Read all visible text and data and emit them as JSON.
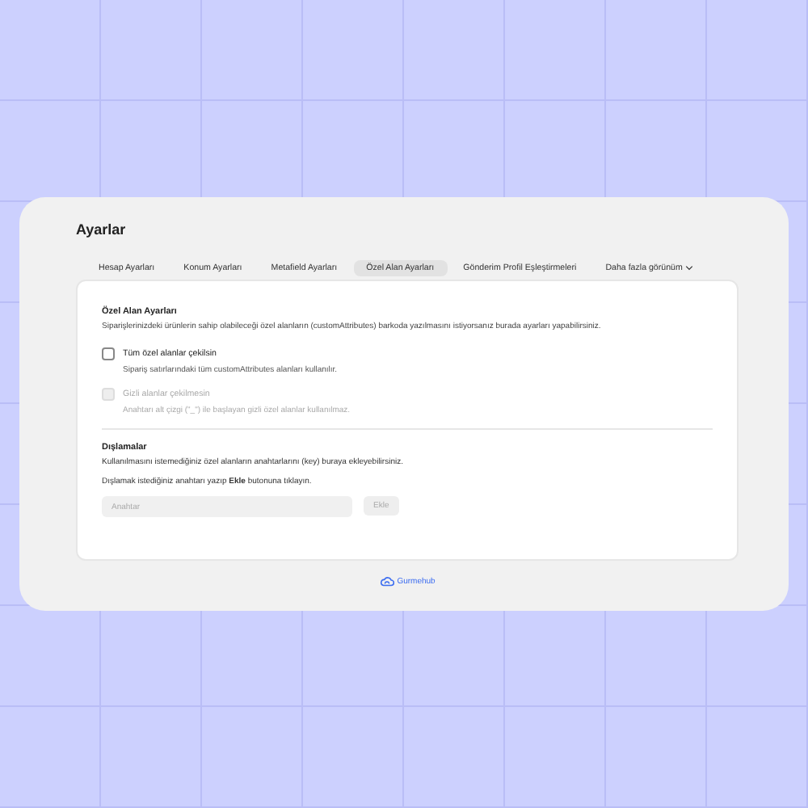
{
  "window": {
    "title": "Ayarlar"
  },
  "tabs": [
    {
      "label": "Hesap Ayarları",
      "selected": false,
      "kind": "tab"
    },
    {
      "label": "Konum Ayarları",
      "selected": false,
      "kind": "tab"
    },
    {
      "label": "Metafield Ayarları",
      "selected": false,
      "kind": "tab"
    },
    {
      "label": "Özel Alan Ayarları",
      "selected": true,
      "kind": "tab"
    },
    {
      "label": "Gönderim Profil Eşleştirmeleri",
      "selected": false,
      "kind": "tab"
    },
    {
      "label": "Daha fazla görünüm",
      "selected": false,
      "kind": "dropdown"
    }
  ],
  "panel": {
    "title": "Özel Alan Ayarları",
    "description": "Siparişlerinizdeki ürünlerin sahip olabileceği özel alanların (customAttributes) barkoda yazılmasını istiyorsanız burada ayarları yapabilirsiniz.",
    "options": [
      {
        "label": "Tüm özel alanlar çekilsin",
        "hint": "Sipariş satırlarındaki tüm customAttributes alanları kullanılır.",
        "checked": false,
        "disabled": false
      },
      {
        "label": "Gizli alanlar çekilmesin",
        "hint": "Anahtarı alt çizgi (\"_\") ile başlayan gizli özel alanlar kullanılmaz.",
        "checked": false,
        "disabled": true
      }
    ],
    "exclusions": {
      "title": "Dışlamalar",
      "line_1": "Kullanılmasını istemediğiniz özel alanların anahtarlarını (key) buraya ekleyebilirsiniz.",
      "line_2": "Dışlamak istediğiniz anahtarı yazıp **Ekle** butonuna tıklayın.",
      "placeholder": "Anahtar",
      "button": {
        "label": "Ekle",
        "disabled": true
      }
    }
  },
  "footer": {
    "brand": "Gurmehub"
  }
}
